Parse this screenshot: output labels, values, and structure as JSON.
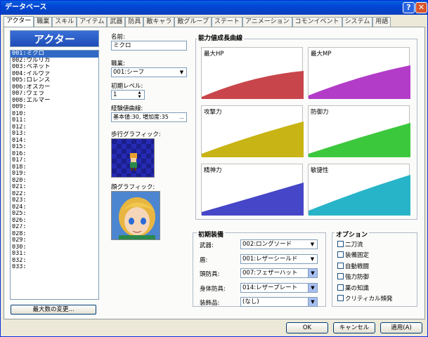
{
  "window": {
    "title": "データベース",
    "help_label": "?",
    "close_label": "✕"
  },
  "tabs": [
    "アクター",
    "職業",
    "スキル",
    "アイテム",
    "武器",
    "防具",
    "敵キャラ",
    "敵グループ",
    "ステート",
    "アニメーション",
    "コモンイベント",
    "システム",
    "用語"
  ],
  "actor_panel": {
    "header": "アクター",
    "items": [
      "001:ミクロ",
      "002:ウルリカ",
      "003:ベネット",
      "004:イルヴァ",
      "005:ロレンス",
      "006:オスカー",
      "007:ヴェラ",
      "008:エルマー",
      "009:",
      "010:",
      "011:",
      "012:",
      "013:",
      "014:",
      "015:",
      "016:",
      "017:",
      "018:",
      "019:",
      "020:",
      "021:",
      "022:",
      "023:",
      "024:",
      "025:",
      "026:",
      "027:",
      "028:",
      "029:",
      "030:",
      "031:",
      "032:",
      "033:"
    ],
    "max_button": "最大数の変更..."
  },
  "form": {
    "name_label": "名前:",
    "name_value": "ミクロ",
    "class_label": "職業:",
    "class_value": "001:シーフ",
    "level_label": "初期レベル:",
    "level_value": "1",
    "exp_label": "経験値曲線:",
    "exp_value": "基本値:30, 増加度:35",
    "exp_button": "...",
    "walk_label": "歩行グラフィック:",
    "face_label": "顔グラフィック:"
  },
  "curves": {
    "title": "能力値成長曲線",
    "graphs": [
      {
        "label": "最大HP",
        "color": "#c8464b"
      },
      {
        "label": "最大MP",
        "color": "#b23cc8"
      },
      {
        "label": "攻撃力",
        "color": "#c8b414"
      },
      {
        "label": "防御力",
        "color": "#3cc83c"
      },
      {
        "label": "精神力",
        "color": "#4646c8"
      },
      {
        "label": "敏捷性",
        "color": "#28b4c8"
      }
    ]
  },
  "equipment": {
    "title": "初期装備",
    "rows": [
      {
        "label": "武器:",
        "value": "002:ロングソード"
      },
      {
        "label": "盾:",
        "value": "001:レザーシールド"
      },
      {
        "label": "頭防具:",
        "value": "007:フェザーハット"
      },
      {
        "label": "身体防具:",
        "value": "014:レザープレート"
      },
      {
        "label": "装飾品:",
        "value": "(なし)"
      }
    ]
  },
  "options": {
    "title": "オプション",
    "items": [
      "二刀流",
      "装備固定",
      "自動戦闘",
      "強力防御",
      "薬の知識",
      "クリティカル頻発"
    ]
  },
  "buttons": {
    "ok": "OK",
    "cancel": "キャンセル",
    "apply": "適用(A)"
  }
}
